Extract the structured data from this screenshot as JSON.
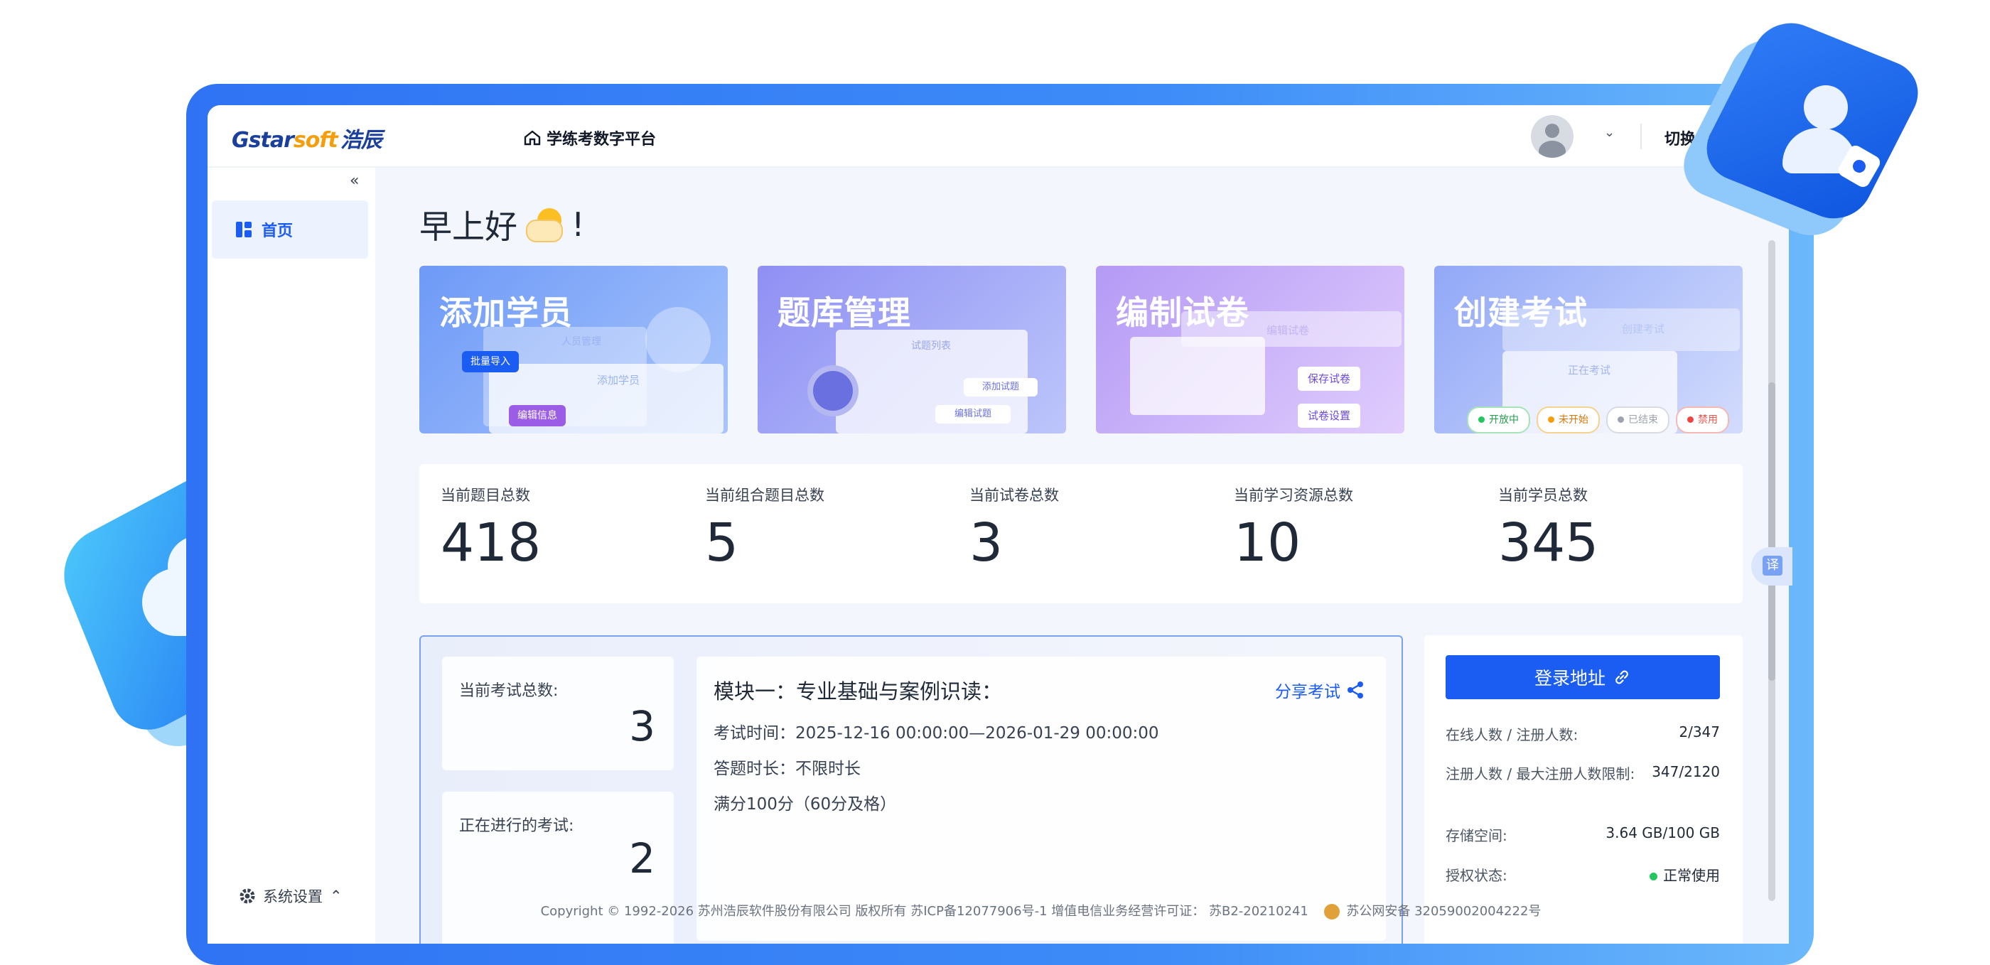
{
  "header": {
    "logo_text_a": "Gstar",
    "logo_text_b": "soft",
    "logo_text_cn": "浩辰",
    "platform": "学练考数字平台",
    "switch_label": "切换学"
  },
  "sidebar": {
    "collapse_glyph": "«",
    "home_label": "首页",
    "settings_label": "系统设置"
  },
  "greeting": {
    "text": "早上好",
    "suffix": "!"
  },
  "cards": [
    {
      "title": "添加学员",
      "chips": [
        "人员管理",
        "批量导入",
        "添加学员",
        "编辑信息"
      ]
    },
    {
      "title": "题库管理",
      "chips": [
        "试题列表",
        "添加试题",
        "编辑试题"
      ]
    },
    {
      "title": "编制试卷",
      "chips": [
        "编辑试卷",
        "保存试卷",
        "试卷设置"
      ]
    },
    {
      "title": "创建考试",
      "chips": [
        "创建考试",
        "正在考试"
      ],
      "statuses": [
        "开放中",
        "未开始",
        "已结束",
        "禁用"
      ]
    }
  ],
  "stats": [
    {
      "label": "当前题目总数",
      "value": "418"
    },
    {
      "label": "当前组合题目总数",
      "value": "5"
    },
    {
      "label": "当前试卷总数",
      "value": "3"
    },
    {
      "label": "当前学习资源总数",
      "value": "10"
    },
    {
      "label": "当前学员总数",
      "value": "345"
    }
  ],
  "exam": {
    "total_label": "当前考试总数:",
    "total_value": "3",
    "running_label": "正在进行的考试:",
    "running_value": "2",
    "title": "模块一：专业基础与案例识读：",
    "share_label": "分享考试",
    "time_line": "考试时间：2025-12-16 00:00:00—2026-01-29 00:00:00",
    "duration_line": "答题时长：不限时长",
    "score_line": "满分100分（60分及格）"
  },
  "info": {
    "login_label": "登录地址",
    "rows": [
      {
        "label": "在线人数 / 注册人数:",
        "value": "2/347"
      },
      {
        "label": "注册人数 / 最大注册人数限制:",
        "value": "347/2120"
      },
      {
        "label": "存储空间:",
        "value": "3.64 GB/100 GB"
      },
      {
        "label": "授权状态:",
        "value": "正常使用"
      }
    ]
  },
  "footer": {
    "copyright": "Copyright © 1992-2026 苏州浩辰软件股份有限公司 版权所有 苏ICP备12077906号-1 增值电信业务经营许可证： 苏B2-20210241",
    "police": "苏公网安备 32059002004222号"
  },
  "translate_label": "译",
  "colors": {
    "primary": "#1b5cf2",
    "frame": "#2f73f4",
    "success": "#22c55e"
  }
}
